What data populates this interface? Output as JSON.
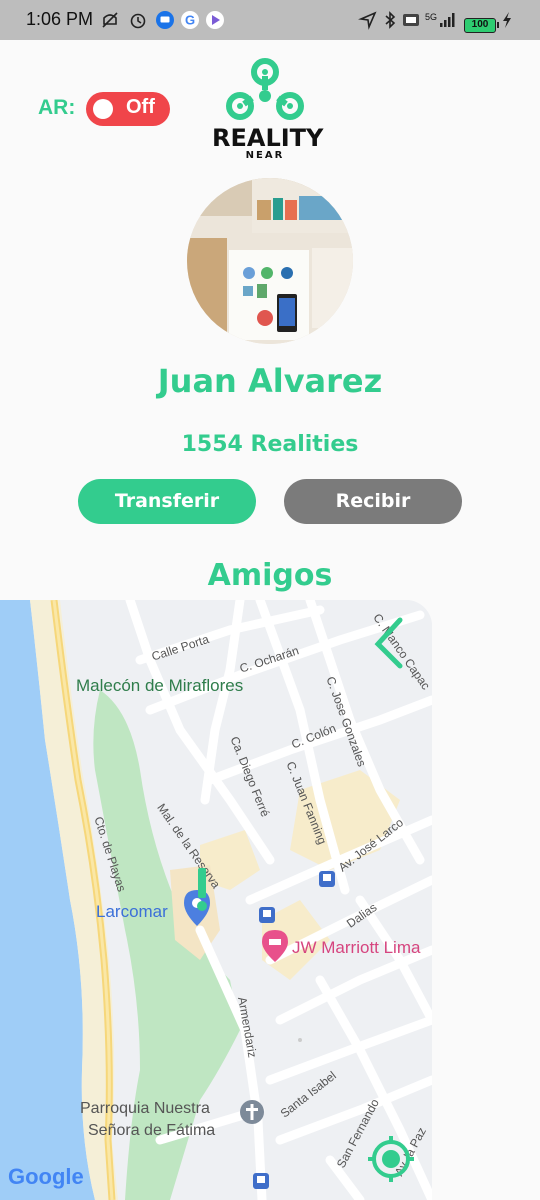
{
  "status_bar": {
    "time": "1:06 PM",
    "network": "5G",
    "battery": "100"
  },
  "ar": {
    "label": "AR:",
    "state": "Off"
  },
  "logo": {
    "title": "REALITY",
    "subtitle": "NEAR"
  },
  "profile": {
    "name": "Juan Alvarez",
    "realities": "1554 Realities"
  },
  "actions": {
    "transfer_label": "Transferir",
    "receive_label": "Recibir"
  },
  "friends": {
    "title": "Amigos"
  },
  "map": {
    "streets": {
      "calle_porta": "Calle Porta",
      "ocharan": "C. Ocharán",
      "manco_capac": "C. Manco Capac",
      "jose_gonzales": "C. Jose Gonzales",
      "colon": "C. Colón",
      "diego_ferre": "Ca. Diego Ferré",
      "juan_fanning": "C. Juan Fanning",
      "reserva": "Mal. de la Reserva",
      "playas": "Cto. de Playas",
      "jose_larco": "Av. José Larco",
      "dalias": "Dalias",
      "armendariz": "Armendariz",
      "santa_isabel": "Santa Isabel",
      "san_fernando": "San Fernando",
      "la_paz": "Av. la Paz"
    },
    "pois": {
      "malecon": "Malecón de Miraflores",
      "larcomar": "Larcomar",
      "marriott": "JW Marriott Lima",
      "parroquia_1": "Parroquia Nuestra",
      "parroquia_2": "Señora de Fátima"
    },
    "attribution": "Google"
  },
  "colors": {
    "accent": "#33cc8e",
    "toggle_off": "#f0454a",
    "secondary_button": "#7b7b7b",
    "water": "#9fcdf7",
    "park": "#bfe6c2"
  }
}
